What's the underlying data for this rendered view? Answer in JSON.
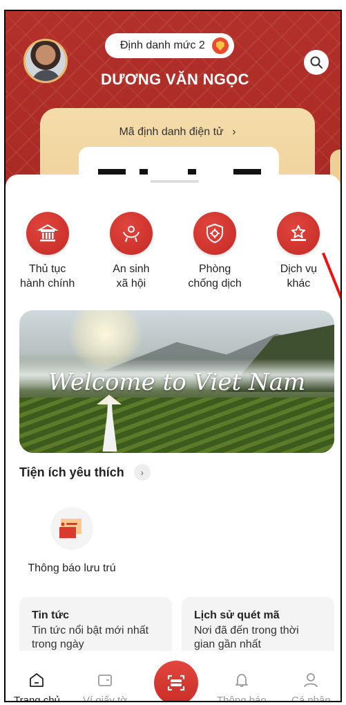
{
  "header": {
    "level_badge": "Định danh mức 2",
    "user_name": "DƯƠNG VĂN NGỌC",
    "id_card_label": "Mã định danh điện tử",
    "id_card_chevron": "›"
  },
  "services": [
    {
      "label": "Thủ tục\nhành chính",
      "icon": "government-building-icon"
    },
    {
      "label": "An sinh\nxã hội",
      "icon": "social-welfare-icon"
    },
    {
      "label": "Phòng\nchống dịch",
      "icon": "virus-shield-icon"
    },
    {
      "label": "Dịch vụ\nkhác",
      "icon": "star-podium-icon"
    }
  ],
  "banner": {
    "text": "Welcome to Viet Nam"
  },
  "favorites": {
    "title": "Tiện ích yêu thích",
    "items": [
      {
        "label": "Thông báo lưu trú",
        "icon": "chat-message-icon"
      }
    ]
  },
  "cards": [
    {
      "title": "Tin tức",
      "desc": "Tin tức nổi bật mới nhất trong ngày"
    },
    {
      "title": "Lịch sử quét mã",
      "desc": "Nơi đã đến trong thời gian gần nhất"
    }
  ],
  "tabbar": {
    "home": "Trang chủ",
    "wallet": "Ví giấy tờ",
    "notifications": "Thông báo",
    "profile": "Cá nhân"
  },
  "colors": {
    "brand_red": "#c42a24",
    "header_red": "#b3302b",
    "card_gold": "#efcf98",
    "annotation_red": "#ee1111"
  }
}
